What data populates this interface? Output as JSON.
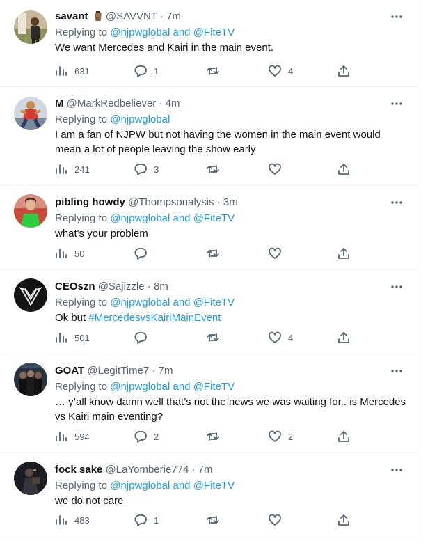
{
  "colors": {
    "link": "#1d9bf0",
    "secondary": "#536471",
    "text": "#0f1419",
    "border": "#eff3f4"
  },
  "tweets": [
    {
      "name": "savant",
      "handle": "@SAVVNT",
      "time": "7m",
      "replying_prefix": "Replying to ",
      "replying_links": "@njpwglobal and @FiteTV",
      "text": "We want Mercedes and Kairi in the main event.",
      "views": "631",
      "replies": "1",
      "retweets": "",
      "likes": "4",
      "avatar": "avatar-person-statue-icon"
    },
    {
      "name": "M",
      "handle": "@MarkRedbeliever",
      "time": "4m",
      "replying_prefix": "Replying to ",
      "replying_links": "@njpwglobal",
      "text": "I am a fan of NJPW but not having the women in the main event would mean a lot of people leaving the show early",
      "views": "241",
      "replies": "3",
      "retweets": "",
      "likes": "",
      "avatar": "avatar-wrestler-icon"
    },
    {
      "name": "pibling howdy",
      "handle": "@Thompsonalysis",
      "time": "3m",
      "replying_prefix": "Replying to ",
      "replying_links": "@njpwglobal and @FiteTV",
      "text": "what's your problem",
      "views": "50",
      "replies": "",
      "retweets": "",
      "likes": "",
      "avatar": "avatar-goalkeeper-icon"
    },
    {
      "name": "CEOszn",
      "handle": "@Sajizzle",
      "time": "8m",
      "replying_prefix": "Replying to ",
      "replying_links": "@njpwglobal and @FiteTV",
      "text_prefix": "Ok but ",
      "hashtag": "#MercedesvsKairiMainEvent",
      "views": "501",
      "replies": "",
      "retweets": "",
      "likes": "4",
      "avatar": "avatar-black-logo-icon"
    },
    {
      "name": "GOAT",
      "handle": "@LegitTime7",
      "time": "7m",
      "replying_prefix": "Replying to ",
      "replying_links": "@njpwglobal and @FiteTV",
      "text": "… y’all know damn well that’s not the news we was waiting for.. is Mercedes vs Kairi main eventing?",
      "views": "594",
      "replies": "2",
      "retweets": "",
      "likes": "2",
      "avatar": "avatar-group-photo-icon"
    },
    {
      "name": "fock sake",
      "handle": "@LaYomberie774",
      "time": "7m",
      "replying_prefix": "Replying to ",
      "replying_links": "@njpwglobal and @FiteTV",
      "text": "we do not care",
      "views": "483",
      "replies": "1",
      "retweets": "",
      "likes": "",
      "avatar": "avatar-dark-photo-icon"
    }
  ]
}
